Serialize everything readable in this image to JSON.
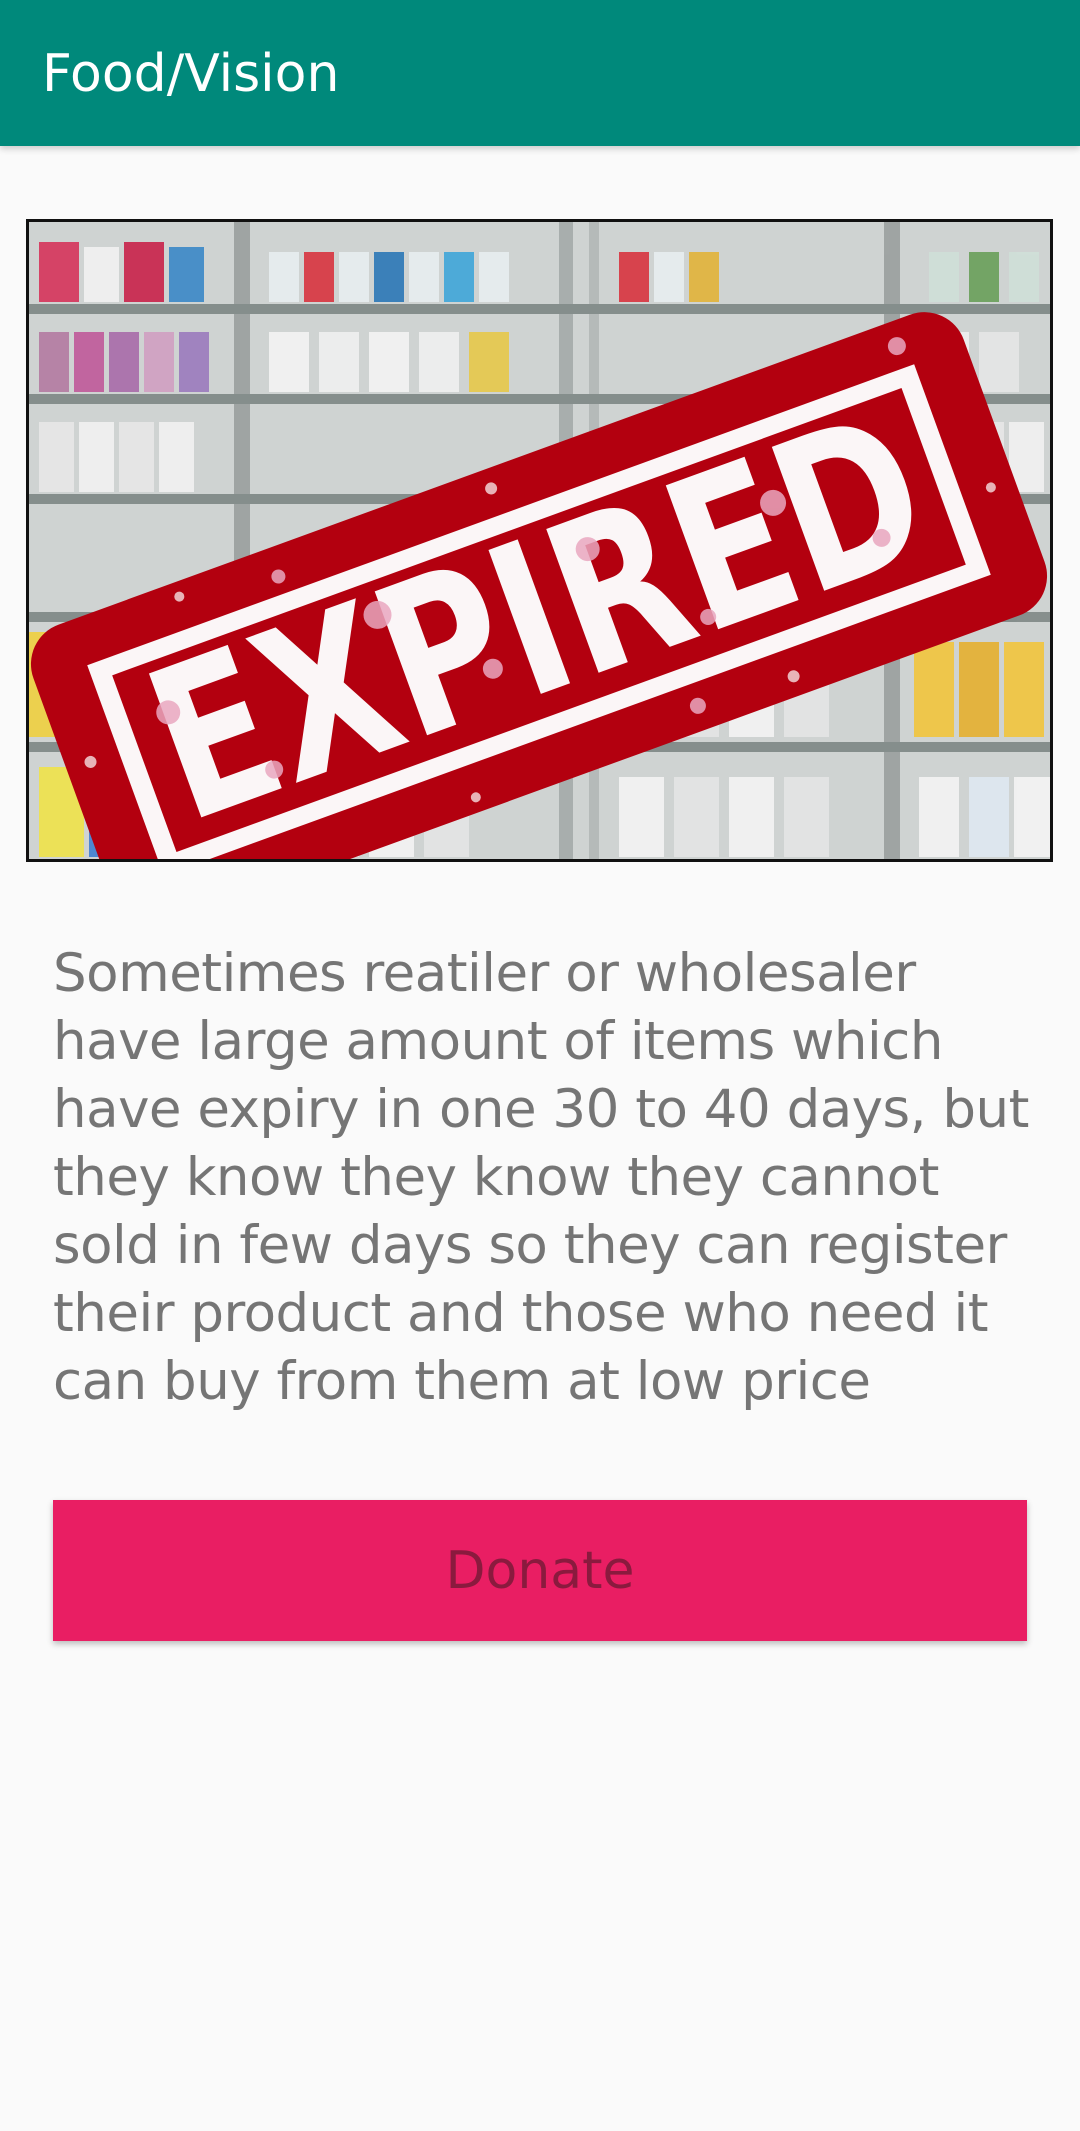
{
  "app_bar": {
    "title": "Food/Vision",
    "color": "#00897b"
  },
  "banner": {
    "stamp_text": "EXPIRED",
    "stamp_color": "#b3000f"
  },
  "description": "Sometimes reatiler or wholesaler have large amount of items which have expiry in one 30 to 40 days, but they know they know they cannot sold in few days so they can register their product and those who need it can buy from them at low price",
  "donate_button": {
    "label": "Donate",
    "color": "#e91e63"
  }
}
